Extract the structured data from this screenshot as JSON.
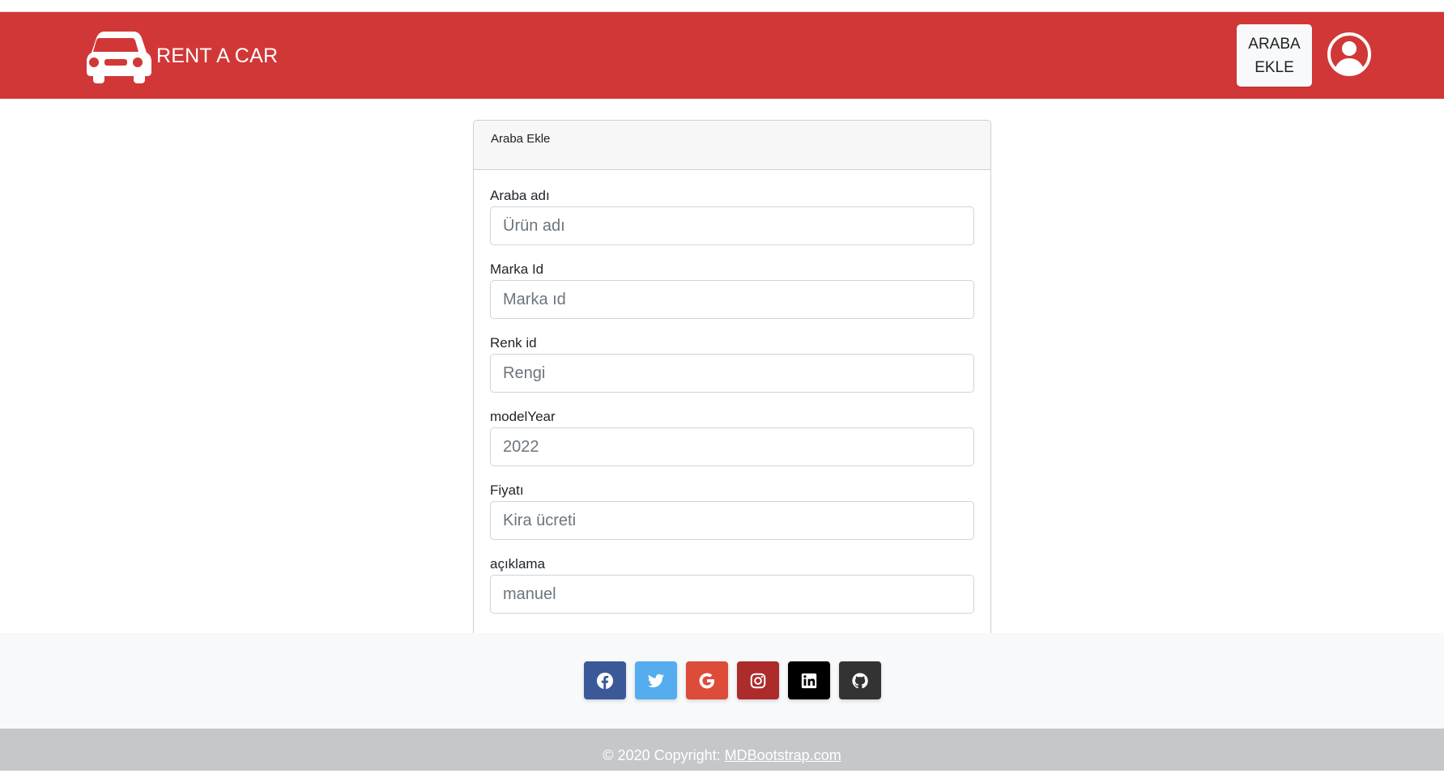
{
  "navbar": {
    "brand_text": "RENT A CAR",
    "add_button_label": "ARABA EKLE",
    "background_color": "#d23737"
  },
  "form": {
    "title": "Araba Ekle",
    "fields": [
      {
        "label": "Araba adı",
        "placeholder": "Ürün adı",
        "value": ""
      },
      {
        "label": "Marka Id",
        "placeholder": "Marka ıd",
        "value": ""
      },
      {
        "label": "Renk id",
        "placeholder": "Rengi",
        "value": ""
      },
      {
        "label": "modelYear",
        "placeholder": "2022",
        "value": ""
      },
      {
        "label": "Fiyatı",
        "placeholder": "Kira ücreti",
        "value": ""
      },
      {
        "label": "açıklama",
        "placeholder": "manuel",
        "value": ""
      }
    ]
  },
  "footer": {
    "social": [
      {
        "icon": "facebook-icon",
        "color": "#3b5998"
      },
      {
        "icon": "twitter-icon",
        "color": "#55acee"
      },
      {
        "icon": "google-icon",
        "color": "#dd4b39"
      },
      {
        "icon": "instagram-icon",
        "color": "#ac2bac"
      },
      {
        "icon": "linkedin-icon",
        "color": "#0082ca"
      },
      {
        "icon": "github-icon",
        "color": "#333333"
      }
    ],
    "copyright_prefix": "© 2020 Copyright: ",
    "copyright_link": "MDBootstrap.com"
  }
}
